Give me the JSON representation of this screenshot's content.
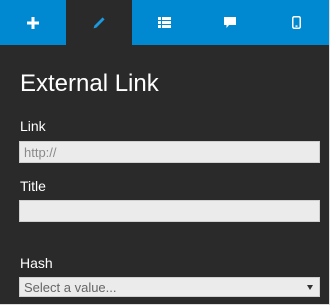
{
  "tabs": [
    {
      "icon": "plus-icon",
      "active": false
    },
    {
      "icon": "pencil-icon",
      "active": true
    },
    {
      "icon": "list-icon",
      "active": false
    },
    {
      "icon": "comment-icon",
      "active": false
    },
    {
      "icon": "mobile-icon",
      "active": false
    }
  ],
  "panel": {
    "title": "External Link",
    "link": {
      "label": "Link",
      "value": "",
      "placeholder": "http://"
    },
    "title_field": {
      "label": "Title",
      "value": "",
      "placeholder": ""
    },
    "hash": {
      "label": "Hash",
      "selected": "Select a value..."
    }
  },
  "colors": {
    "tab_bar": "#0088d1",
    "panel_background": "#2a2a2a",
    "input_background": "#ebebeb",
    "pencil_active": "#1a9ae0"
  }
}
